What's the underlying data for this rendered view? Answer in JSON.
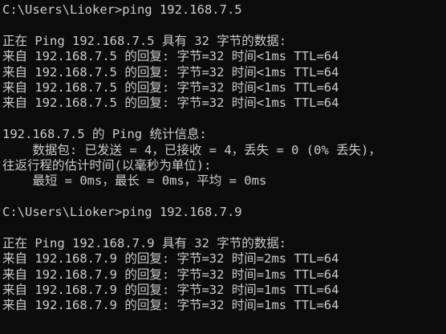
{
  "window": {
    "colors": {
      "background": "#0c0c0c",
      "foreground": "#cccccc"
    }
  },
  "console": {
    "lines": [
      "C:\\Users\\Lioker>ping 192.168.7.5",
      "",
      "正在 Ping 192.168.7.5 具有 32 字节的数据:",
      "来自 192.168.7.5 的回复: 字节=32 时间<1ms TTL=64",
      "来自 192.168.7.5 的回复: 字节=32 时间<1ms TTL=64",
      "来自 192.168.7.5 的回复: 字节=32 时间<1ms TTL=64",
      "来自 192.168.7.5 的回复: 字节=32 时间<1ms TTL=64",
      "",
      "192.168.7.5 的 Ping 统计信息:",
      "    数据包: 已发送 = 4，已接收 = 4，丢失 = 0 (0% 丢失)，",
      "往返行程的估计时间(以毫秒为单位):",
      "    最短 = 0ms，最长 = 0ms，平均 = 0ms",
      "",
      "C:\\Users\\Lioker>ping 192.168.7.9",
      "",
      "正在 Ping 192.168.7.9 具有 32 字节的数据:",
      "来自 192.168.7.9 的回复: 字节=32 时间=2ms TTL=64",
      "来自 192.168.7.9 的回复: 字节=32 时间=1ms TTL=64",
      "来自 192.168.7.9 的回复: 字节=32 时间=1ms TTL=64",
      "来自 192.168.7.9 的回复: 字节=32 时间=1ms TTL=64"
    ]
  }
}
